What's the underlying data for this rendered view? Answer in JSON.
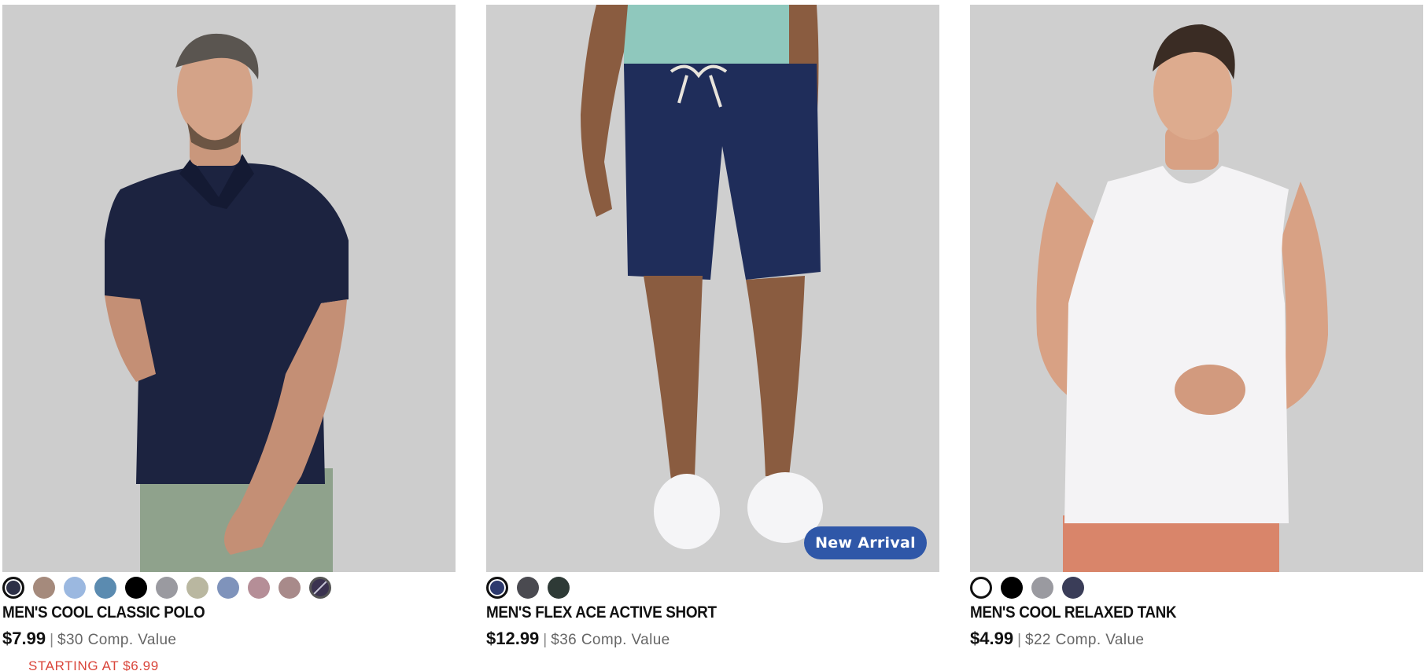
{
  "products": [
    {
      "name": "MEN'S COOL CLASSIC POLO",
      "price": "$7.99",
      "separator": "|",
      "comp_value": "$30 Comp. Value",
      "promo": "STARTING AT $6.99",
      "swatches": [
        "#2d3047",
        "#a58a7c",
        "#9bb8e0",
        "#5b8bb0",
        "#000000",
        "#9a9aa0",
        "#b9b7a0",
        "#7f93bb",
        "#b58e97",
        "#a88a8a",
        "#3b3350"
      ],
      "selected_swatch": 0
    },
    {
      "name": "MEN'S FLEX ACE ACTIVE SHORT",
      "price": "$12.99",
      "separator": "|",
      "comp_value": "$36 Comp. Value",
      "badge": "New Arrival",
      "swatches": [
        "#2d3a6e",
        "#4a4a50",
        "#2e3a36"
      ],
      "selected_swatch": 0
    },
    {
      "name": "MEN'S COOL RELAXED TANK",
      "price": "$4.99",
      "separator": "|",
      "comp_value": "$22 Comp. Value",
      "swatches": [
        "#ffffff",
        "#000000",
        "#9a9aa0",
        "#3a3d58"
      ],
      "selected_swatch": 0
    }
  ]
}
